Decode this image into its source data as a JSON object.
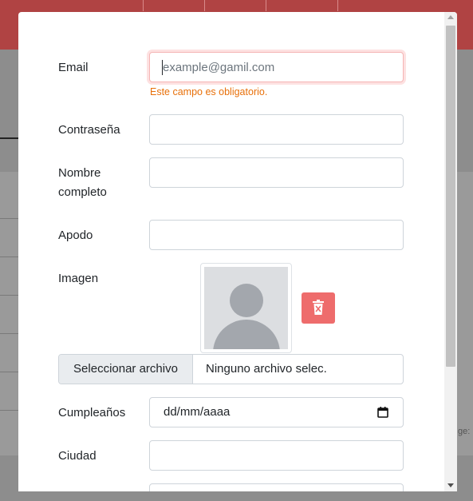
{
  "form": {
    "email_label": "Email",
    "email_placeholder": "example@gamil.com",
    "email_error": "Este campo es obligatorio.",
    "password_label": "Contraseña",
    "fullname_label_line1": "Nombre",
    "fullname_label_line2": "completo",
    "nickname_label": "Apodo",
    "image_label": "Imagen",
    "file_button_label": "Seleccionar archivo",
    "file_status": "Ninguno archivo selec.",
    "birthday_label": "Cumpleaños",
    "birthday_placeholder": "dd/mm/aaaa",
    "city_label": "Ciudad"
  },
  "background": {
    "peek_text": "ge:"
  },
  "icons": {
    "delete": "trash-icon",
    "calendar": "calendar-icon",
    "avatar": "user-placeholder-icon"
  },
  "colors": {
    "header": "#b04343",
    "error_text": "#e8700a",
    "delete_button": "#ee6c6c",
    "invalid_border": "#f5b5b5"
  }
}
